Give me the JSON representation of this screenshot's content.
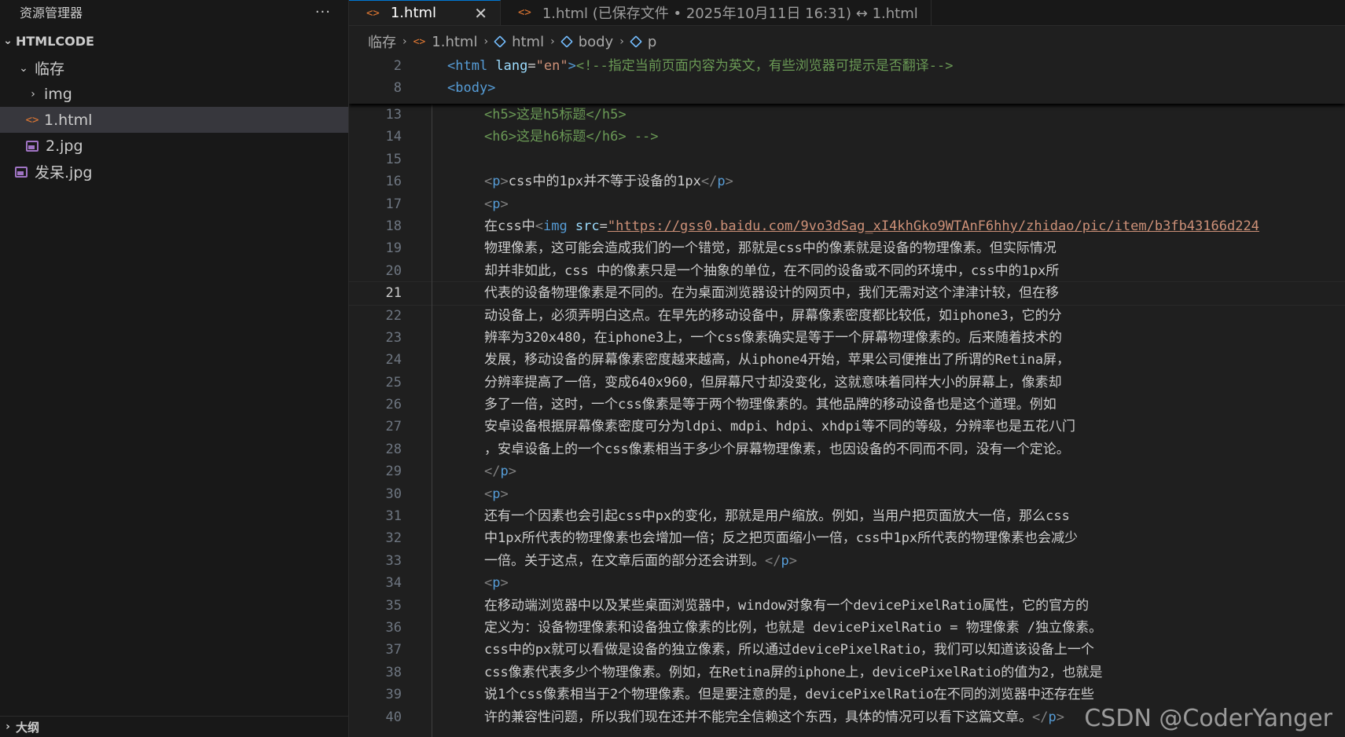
{
  "explorer": {
    "title": "资源管理器",
    "more": "···",
    "section": "HTMLCODE",
    "items": [
      {
        "label": "临存",
        "type": "folder-open",
        "level": 1
      },
      {
        "label": "img",
        "type": "folder-closed",
        "level": 2
      },
      {
        "label": "1.html",
        "type": "html",
        "level": 2,
        "selected": true
      },
      {
        "label": "2.jpg",
        "type": "image",
        "level": 2
      },
      {
        "label": "发呆.jpg",
        "type": "image",
        "level": 1
      }
    ],
    "outline": "大纲"
  },
  "tabs": [
    {
      "label": "1.html",
      "active": true,
      "close": "✕"
    },
    {
      "label": "1.html (已保存文件 • 2025年10月11日 16:31) ↔ 1.html",
      "active": false
    }
  ],
  "breadcrumb": [
    "临存",
    "1.html",
    "html",
    "body",
    "p"
  ],
  "editor": {
    "sticky": [
      {
        "n": "2",
        "tokens": [
          [
            "t-tag",
            "<html "
          ],
          [
            "t-attr",
            "lang"
          ],
          [
            "",
            "="
          ],
          [
            "t-str",
            "\"en\""
          ],
          [
            "t-tag",
            ">"
          ],
          [
            "t-cmt",
            "<!--指定当前页面内容为英文，有些浏览器可提示是否翻译-->"
          ]
        ]
      },
      {
        "n": "8",
        "tokens": [
          [
            "t-tag",
            "<body>"
          ]
        ]
      }
    ],
    "lines": [
      {
        "n": "13",
        "tokens": [
          [
            "t-cmt",
            "<h5>这是h5标题</h5>"
          ]
        ]
      },
      {
        "n": "14",
        "tokens": [
          [
            "t-cmt",
            "<h6>这是h6标题</h6> -->"
          ]
        ]
      },
      {
        "n": "15",
        "tokens": []
      },
      {
        "n": "16",
        "tokens": [
          [
            "t-br",
            "<"
          ],
          [
            "t-tag",
            "p"
          ],
          [
            "t-br",
            ">"
          ],
          [
            "",
            "css中的1px并不等于设备的1px"
          ],
          [
            "t-br",
            "</"
          ],
          [
            "t-tag",
            "p"
          ],
          [
            "t-br",
            ">"
          ]
        ]
      },
      {
        "n": "17",
        "tokens": [
          [
            "t-br",
            "<"
          ],
          [
            "t-tag",
            "p"
          ],
          [
            "t-br",
            ">"
          ]
        ]
      },
      {
        "n": "18",
        "tokens": [
          [
            "",
            "在css中"
          ],
          [
            "t-br",
            "<"
          ],
          [
            "t-tag",
            "img "
          ],
          [
            "t-attr",
            "src"
          ],
          [
            "",
            "="
          ],
          [
            "t-url",
            "\"https://gss0.baidu.com/9vo3dSag_xI4khGko9WTAnF6hhy/zhidao/pic/item/b3fb43166d224"
          ]
        ]
      },
      {
        "n": "19",
        "tokens": [
          [
            "",
            "物理像素，这可能会造成我们的一个错觉，那就是css中的像素就是设备的物理像素。但实际情况"
          ]
        ]
      },
      {
        "n": "20",
        "tokens": [
          [
            "",
            "却并非如此，css 中的像素只是一个抽象的单位，在不同的设备或不同的环境中，css中的1px所"
          ]
        ]
      },
      {
        "n": "21",
        "tokens": [
          [
            "",
            "代表的设备物理像素是不同的。在为桌面浏览器设计的网页中，我们无需对这个津津计较，但在移"
          ]
        ],
        "current": true
      },
      {
        "n": "22",
        "tokens": [
          [
            "",
            "动设备上，必须弄明白这点。在早先的移动设备中，屏幕像素密度都比较低，如iphone3，它的分"
          ]
        ]
      },
      {
        "n": "23",
        "tokens": [
          [
            "",
            "辨率为320x480，在iphone3上，一个css像素确实是等于一个屏幕物理像素的。后来随着技术的"
          ]
        ]
      },
      {
        "n": "24",
        "tokens": [
          [
            "",
            "发展，移动设备的屏幕像素密度越来越高，从iphone4开始，苹果公司便推出了所谓的Retina屏，"
          ]
        ]
      },
      {
        "n": "25",
        "tokens": [
          [
            "",
            "分辨率提高了一倍，变成640x960，但屏幕尺寸却没变化，这就意味着同样大小的屏幕上，像素却"
          ]
        ]
      },
      {
        "n": "26",
        "tokens": [
          [
            "",
            "多了一倍，这时，一个css像素是等于两个物理像素的。其他品牌的移动设备也是这个道理。例如"
          ]
        ]
      },
      {
        "n": "27",
        "tokens": [
          [
            "",
            "安卓设备根据屏幕像素密度可分为ldpi、mdpi、hdpi、xhdpi等不同的等级，分辨率也是五花八门"
          ]
        ]
      },
      {
        "n": "28",
        "tokens": [
          [
            "",
            "，安卓设备上的一个css像素相当于多少个屏幕物理像素，也因设备的不同而不同，没有一个定论。"
          ]
        ]
      },
      {
        "n": "29",
        "tokens": [
          [
            "t-br",
            "</"
          ],
          [
            "t-tag",
            "p"
          ],
          [
            "t-br",
            ">"
          ]
        ]
      },
      {
        "n": "30",
        "tokens": [
          [
            "t-br",
            "<"
          ],
          [
            "t-tag",
            "p"
          ],
          [
            "t-br",
            ">"
          ]
        ]
      },
      {
        "n": "31",
        "tokens": [
          [
            "",
            "还有一个因素也会引起css中px的变化，那就是用户缩放。例如，当用户把页面放大一倍，那么css"
          ]
        ]
      },
      {
        "n": "32",
        "tokens": [
          [
            "",
            "中1px所代表的物理像素也会增加一倍；反之把页面缩小一倍，css中1px所代表的物理像素也会减少"
          ]
        ]
      },
      {
        "n": "33",
        "tokens": [
          [
            "",
            "一倍。关于这点，在文章后面的部分还会讲到。"
          ],
          [
            "t-br",
            "</"
          ],
          [
            "t-tag",
            "p"
          ],
          [
            "t-br",
            ">"
          ]
        ]
      },
      {
        "n": "34",
        "tokens": [
          [
            "t-br",
            "<"
          ],
          [
            "t-tag",
            "p"
          ],
          [
            "t-br",
            ">"
          ]
        ]
      },
      {
        "n": "35",
        "tokens": [
          [
            "",
            "在移动端浏览器中以及某些桌面浏览器中，window对象有一个devicePixelRatio属性，它的官方的"
          ]
        ]
      },
      {
        "n": "36",
        "tokens": [
          [
            "",
            "定义为：设备物理像素和设备独立像素的比例，也就是 devicePixelRatio = 物理像素 /独立像素。"
          ]
        ]
      },
      {
        "n": "37",
        "tokens": [
          [
            "",
            "css中的px就可以看做是设备的独立像素，所以通过devicePixelRatio，我们可以知道该设备上一个"
          ]
        ]
      },
      {
        "n": "38",
        "tokens": [
          [
            "",
            "css像素代表多少个物理像素。例如，在Retina屏的iphone上，devicePixelRatio的值为2，也就是"
          ]
        ]
      },
      {
        "n": "39",
        "tokens": [
          [
            "",
            "说1个css像素相当于2个物理像素。但是要注意的是，devicePixelRatio在不同的浏览器中还存在些"
          ]
        ]
      },
      {
        "n": "40",
        "tokens": [
          [
            "",
            "许的兼容性问题，所以我们现在还并不能完全信赖这个东西，具体的情况可以看下这篇文章。"
          ],
          [
            "t-br",
            "</"
          ],
          [
            "t-tag",
            "p"
          ],
          [
            "t-br",
            ">"
          ]
        ]
      }
    ]
  },
  "watermark": "CSDN @CoderYanger"
}
